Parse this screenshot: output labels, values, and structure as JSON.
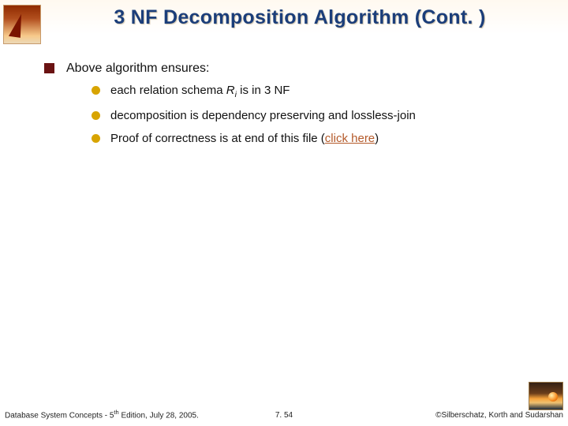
{
  "title": "3 NF Decomposition Algorithm (Cont. )",
  "bullet_lvl1": "Above algorithm ensures:",
  "sub_bullets": {
    "b1_pre": "each relation schema ",
    "b1_var": "R",
    "b1_sub": "i",
    "b1_post": " is in 3 NF",
    "b2": "decomposition is dependency preserving and lossless-join",
    "b3_pre": "Proof of correctness is at end of this file (",
    "b3_link": "click here",
    "b3_post": ")"
  },
  "footer": {
    "left_pre": "Database System Concepts - 5",
    "left_sup": "th",
    "left_post": " Edition, July 28, 2005.",
    "center": "7. 54",
    "right": "©Silberschatz, Korth and Sudarshan"
  }
}
